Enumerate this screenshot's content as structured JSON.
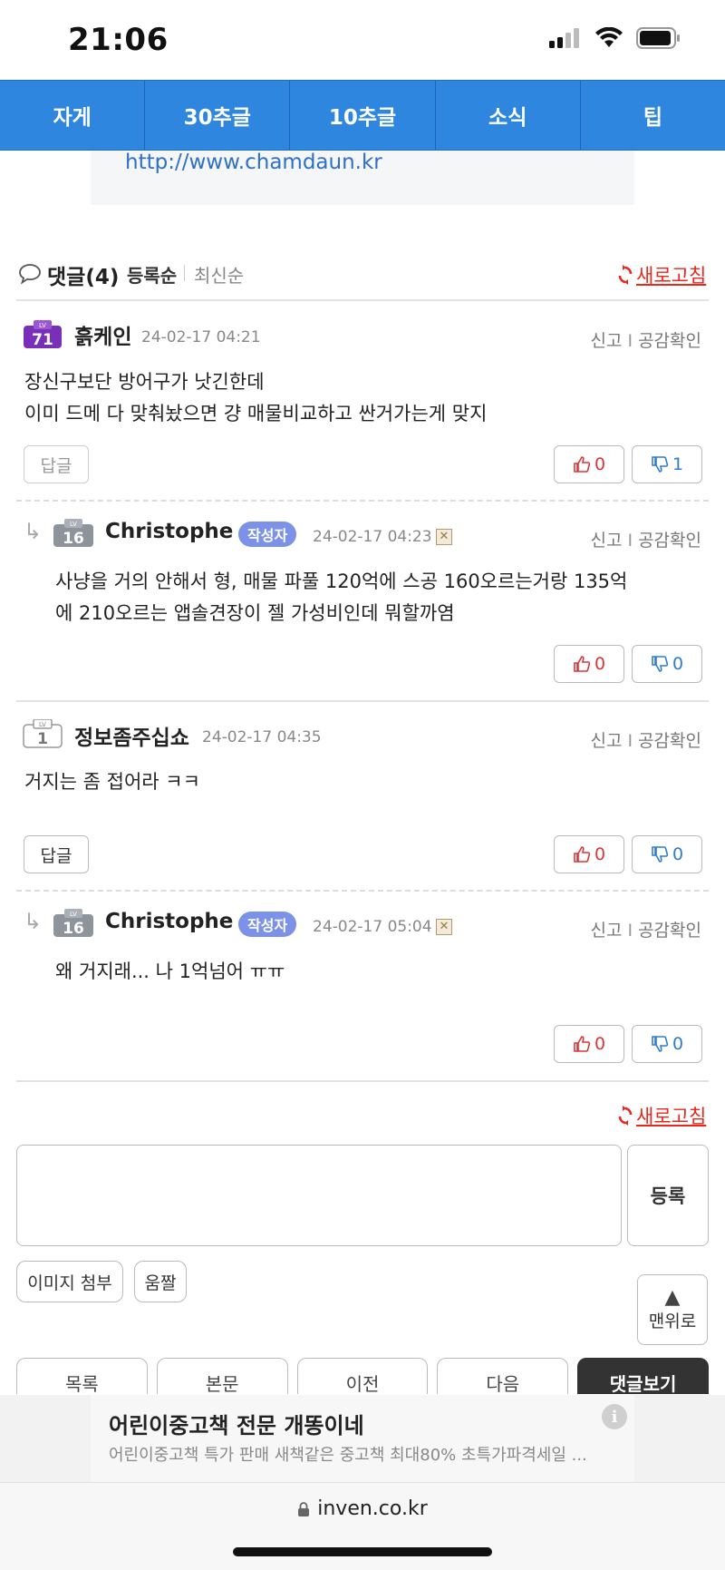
{
  "status": {
    "time": "21:06"
  },
  "nav": {
    "items": [
      "자게",
      "30추글",
      "10추글",
      "소식",
      "팁"
    ]
  },
  "link": {
    "text": "http://www.chamdaun.kr"
  },
  "comments_header": {
    "title": "댓글(4)",
    "sort_active": "등록순",
    "sort_other": "최신순",
    "refresh": "새로고침"
  },
  "actions": {
    "report": "신고",
    "sep": "I",
    "likes": "공감확인"
  },
  "author_badge": "작성자",
  "comments": [
    {
      "level": "71",
      "nick": "흙케인",
      "date": "24-02-17 04:21",
      "lines": [
        "장신구보단 방어구가 낫긴한데",
        "이미 드메 다 맞춰놨으면 걍 매물비교하고 싼거가는게 맞지"
      ],
      "reply": "답글",
      "up": "0",
      "down": "1"
    },
    {
      "level": "16",
      "nick": "Christophe",
      "date": "24-02-17 04:23",
      "lines": [
        "사냥을 거의 안해서 형, 매물 파풀 120억에 스공 160오르는거랑 135억",
        "에 210오르는 앱솔견장이 젤 가성비인데 뭐할까염"
      ],
      "up": "0",
      "down": "0"
    },
    {
      "level": "1",
      "nick": "정보좀주십쇼",
      "date": "24-02-17 04:35",
      "lines": [
        "거지는 좀 접어라 ㅋㅋ"
      ],
      "reply": "답글",
      "up": "0",
      "down": "0"
    },
    {
      "level": "16",
      "nick": "Christophe",
      "date": "24-02-17 05:04",
      "lines": [
        "왜 거지래... 나 1억넘어 ㅠㅠ"
      ],
      "up": "0",
      "down": "0"
    }
  ],
  "form": {
    "submit": "등록",
    "attach_image": "이미지 첨부",
    "emoticon": "움짤",
    "to_top": "맨위로"
  },
  "bottom_tabs": [
    "목록",
    "본문",
    "이전",
    "다음",
    "댓글보기"
  ],
  "ad": {
    "title": "어린이중고책 전문 개똥이네",
    "desc": "어린이중고책 특가 판매 새책같은 중고책 최대80% 초특가파격세일 ...",
    "info": "i"
  },
  "url": "inven.co.kr",
  "colors": {
    "nav_bg": "#2e86de",
    "refresh": "#e8271d",
    "badge": "#7b92e8",
    "up": "#d9373a",
    "down": "#2e7bd0"
  }
}
